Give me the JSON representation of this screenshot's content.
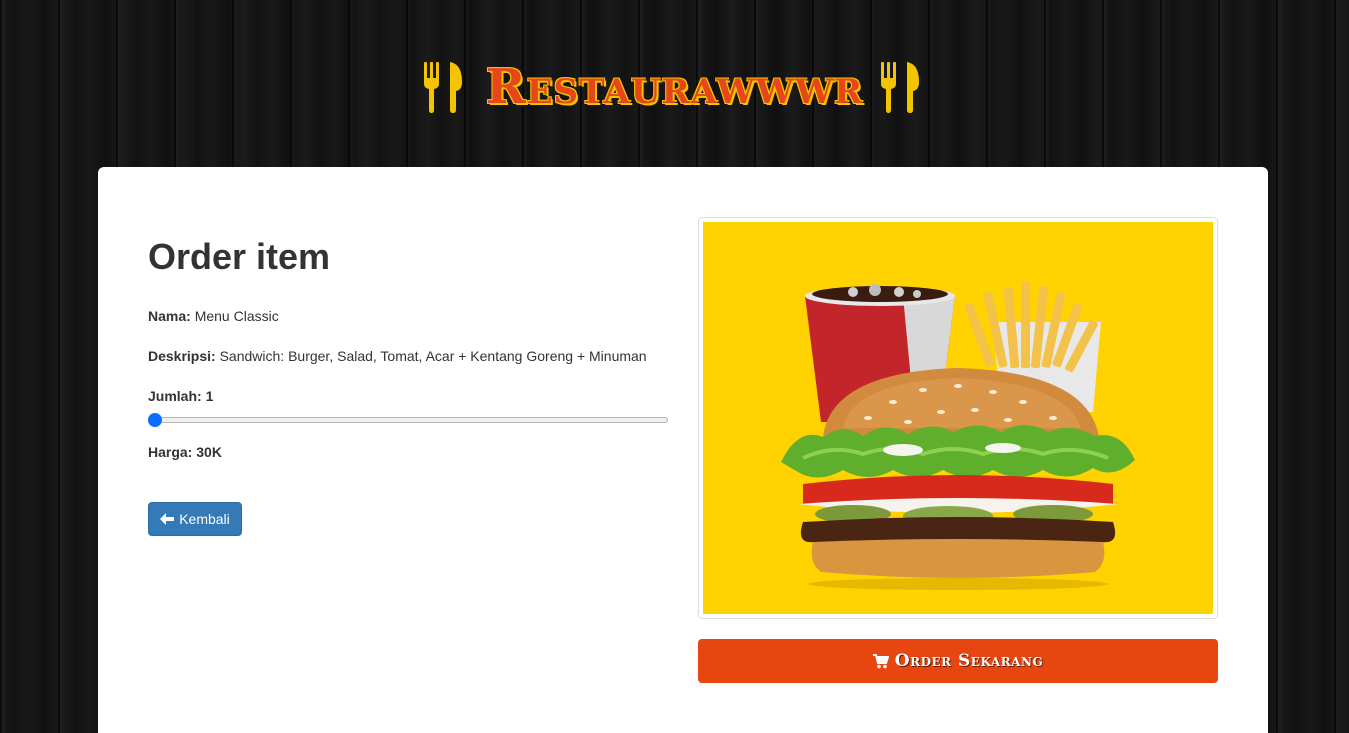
{
  "header": {
    "brand": "Restaurawwwr",
    "left_icon": "utensils-icon",
    "right_icon": "utensils-icon",
    "brand_color": "#e6471a",
    "icon_color": "#f5c400"
  },
  "order": {
    "title": "Order item",
    "nama_label": "Nama:",
    "nama_value": "Menu Classic",
    "deskripsi_label": "Deskripsi:",
    "deskripsi_value": "Sandwich: Burger, Salad, Tomat, Acar + Kentang Goreng + Minuman",
    "jumlah_label": "Jumlah:",
    "jumlah_value": "1",
    "slider_min": 1,
    "slider_max": 10,
    "slider_value": 1,
    "harga_label": "Harga:",
    "harga_value": "30K",
    "back_button": "Kembali",
    "back_icon": "arrow-left-icon"
  },
  "product": {
    "image_alt": "burger-meal-photo",
    "order_button": "Order Sekarang",
    "order_icon": "cart-icon",
    "order_color": "#e74611",
    "photo_bg": "#ffd200"
  }
}
